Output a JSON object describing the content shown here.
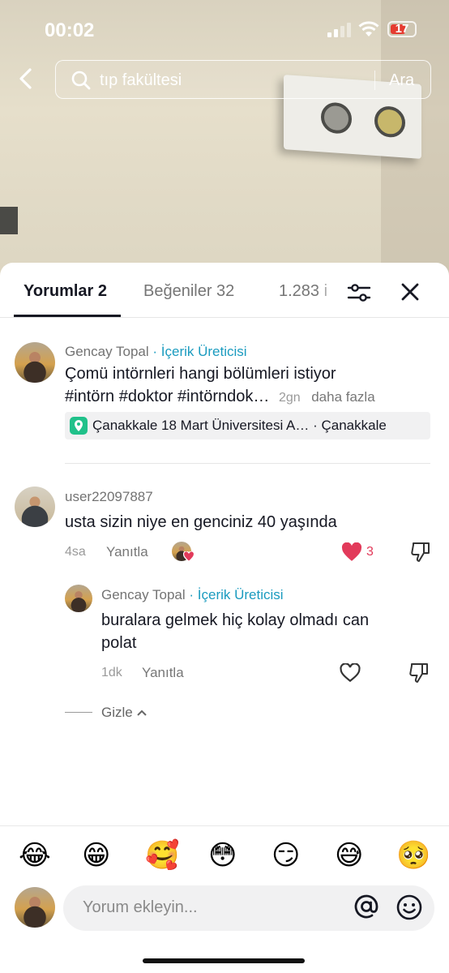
{
  "status": {
    "time": "00:02",
    "battery": "17"
  },
  "search": {
    "query": "tıp fakültesi",
    "button": "Ara"
  },
  "tabs": [
    {
      "label": "Yorumlar 2"
    },
    {
      "label": "Beğeniler 32"
    },
    {
      "label": "1.283 i"
    }
  ],
  "post": {
    "author": "Gencay Topal",
    "badge": "· İçerik Üreticisi",
    "line1": "Çomü intörnleri hangi bölümleri istiyor",
    "line2": "#intörn #doktor #intörndok…",
    "time": "2gn",
    "more": "daha fazla",
    "location": "Çanakkale 18 Mart Üniversitesi A… · Çanakkale"
  },
  "comment": {
    "author": "user22097887",
    "text": "usta sizin niye en genciniz 40 yaşında",
    "time": "4sa",
    "reply": "Yanıtla",
    "likes": "3"
  },
  "reply": {
    "author": "Gencay Topal",
    "badge": "· İçerik Üreticisi",
    "line1": "buralara gelmek hiç kolay olmadı can",
    "line2": "polat",
    "time": "1dk",
    "reply": "Yanıtla"
  },
  "hide_label": "Gizle",
  "emojis": [
    "😂",
    "😁",
    "🥰",
    "😳",
    "😏",
    "😅",
    "🥺"
  ],
  "input": {
    "placeholder": "Yorum ekleyin..."
  },
  "colors": {
    "accent": "#1a9bbf",
    "like": "#e23a5a",
    "location_pin": "#20c18a"
  }
}
